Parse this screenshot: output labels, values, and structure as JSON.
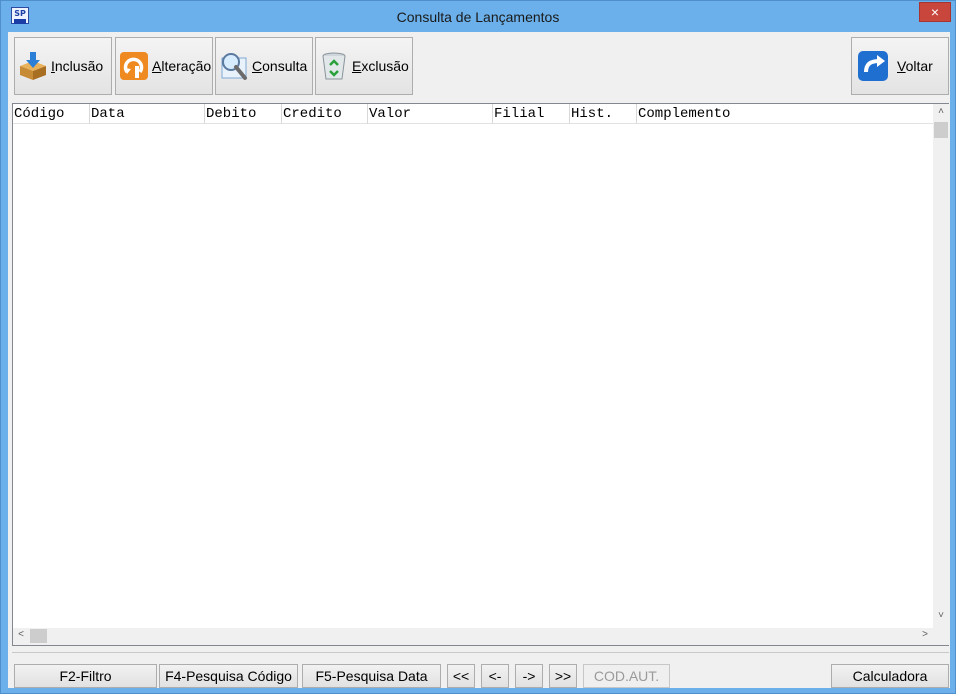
{
  "window": {
    "title": "Consulta  de Lançamentos",
    "app_icon_text": "SP",
    "close_label": "×"
  },
  "toolbar": {
    "inclusao": {
      "underline": "I",
      "rest": "nclusão"
    },
    "alteracao": {
      "underline": "A",
      "rest": "lteração"
    },
    "consulta": {
      "underline": "C",
      "rest": "onsulta"
    },
    "exclusao": {
      "underline": "E",
      "rest": "xclusão"
    },
    "voltar": {
      "underline": "V",
      "rest": "oltar"
    }
  },
  "grid": {
    "columns": [
      "Código",
      "Data",
      "Debito",
      "Credito",
      "Valor",
      "Filial",
      "Hist.",
      "Complemento"
    ],
    "rows": []
  },
  "scroll": {
    "up": "˄",
    "down": "˅",
    "left": "<",
    "right": ">"
  },
  "bottom": {
    "filtro": "F2-Filtro",
    "pesquisa_codigo": "F4-Pesquisa Código",
    "pesquisa_data": "F5-Pesquisa Data",
    "first": "<<",
    "prev": "<-",
    "next": "->",
    "last": ">>",
    "cod_aut": "COD.AUT.",
    "calculadora": "Calculadora"
  },
  "colors": {
    "titlebar": "#6bb0ea",
    "close": "#c9463d",
    "client": "#f0f0f0"
  }
}
